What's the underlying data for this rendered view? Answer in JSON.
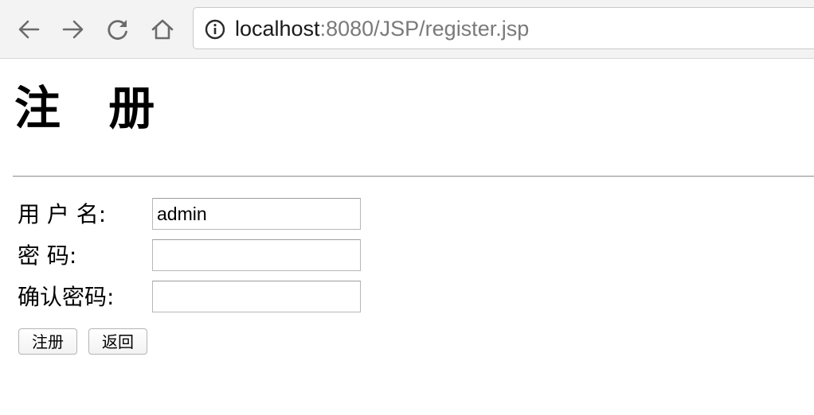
{
  "browser": {
    "url_host": "localhost",
    "url_rest": ":8080/JSP/register.jsp"
  },
  "page": {
    "title": "注 册"
  },
  "form": {
    "username_label": "用 户 名:",
    "username_value": "admin",
    "password_label": "密 码:",
    "password_value": "",
    "confirm_label": "确认密码:",
    "confirm_value": "",
    "register_button": "注册",
    "back_button": "返回"
  },
  "icons": {
    "back": "arrow-left-icon",
    "forward": "arrow-right-icon",
    "reload": "reload-icon",
    "home": "home-icon",
    "info": "info-icon"
  },
  "colors": {
    "toolbar_bg": "#f3f3f3",
    "icon_gray": "#6b6b6b",
    "url_path": "#7a7a7a"
  }
}
